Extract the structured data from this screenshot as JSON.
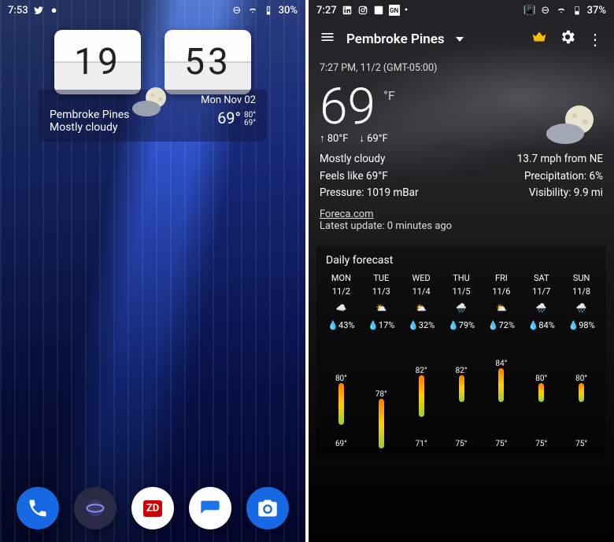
{
  "left": {
    "status": {
      "time": "7:53",
      "battery": "30%"
    },
    "widget": {
      "hours": "19",
      "minutes": "53",
      "date": "Mon Nov 02",
      "city": "Pembroke Pines",
      "cond": "Mostly cloudy",
      "temp": "69°",
      "hi": "80°",
      "lo": "69°"
    }
  },
  "right": {
    "status": {
      "time": "7:27",
      "battery": "37%"
    },
    "header": {
      "title": "Pembroke Pines"
    },
    "meta": "7:27 PM, 11/2 (GMT-05:00)",
    "temp": "69",
    "unit": "°F",
    "hi": "80°F",
    "lo": "69°F",
    "left_lines": [
      "Mostly cloudy",
      "Feels like 69°F",
      "Pressure: 1019 mBar"
    ],
    "right_lines": [
      "13.7 mph from NE",
      "Precipitation: 6%",
      "Visibility: 9.9 mi"
    ],
    "source": "Foreca.com",
    "updated": "Latest update: 0 minutes ago",
    "panel_title": "Daily forecast",
    "days": [
      {
        "dow": "MON",
        "date": "11/2",
        "precip": "43%",
        "hi": "80°",
        "lo": "69°"
      },
      {
        "dow": "TUE",
        "date": "11/3",
        "precip": "17%",
        "hi": "78°",
        "lo": ""
      },
      {
        "dow": "WED",
        "date": "11/4",
        "precip": "32%",
        "hi": "82°",
        "lo": "71°"
      },
      {
        "dow": "THU",
        "date": "11/5",
        "precip": "79%",
        "hi": "82°",
        "lo": "75°"
      },
      {
        "dow": "FRI",
        "date": "11/6",
        "precip": "72%",
        "hi": "84°",
        "lo": "75°"
      },
      {
        "dow": "SAT",
        "date": "11/7",
        "precip": "84%",
        "hi": "80°",
        "lo": "75°"
      },
      {
        "dow": "SUN",
        "date": "11/8",
        "precip": "98%",
        "hi": "80°",
        "lo": "75°"
      }
    ]
  },
  "chart_data": {
    "type": "bar",
    "title": "Daily forecast high/low (°F)",
    "categories": [
      "11/2",
      "11/3",
      "11/4",
      "11/5",
      "11/6",
      "11/7",
      "11/8"
    ],
    "series": [
      {
        "name": "High",
        "values": [
          80,
          78,
          82,
          82,
          84,
          80,
          80
        ]
      },
      {
        "name": "Low",
        "values": [
          69,
          null,
          71,
          75,
          75,
          75,
          75
        ]
      }
    ],
    "ylim": [
      65,
      90
    ]
  }
}
